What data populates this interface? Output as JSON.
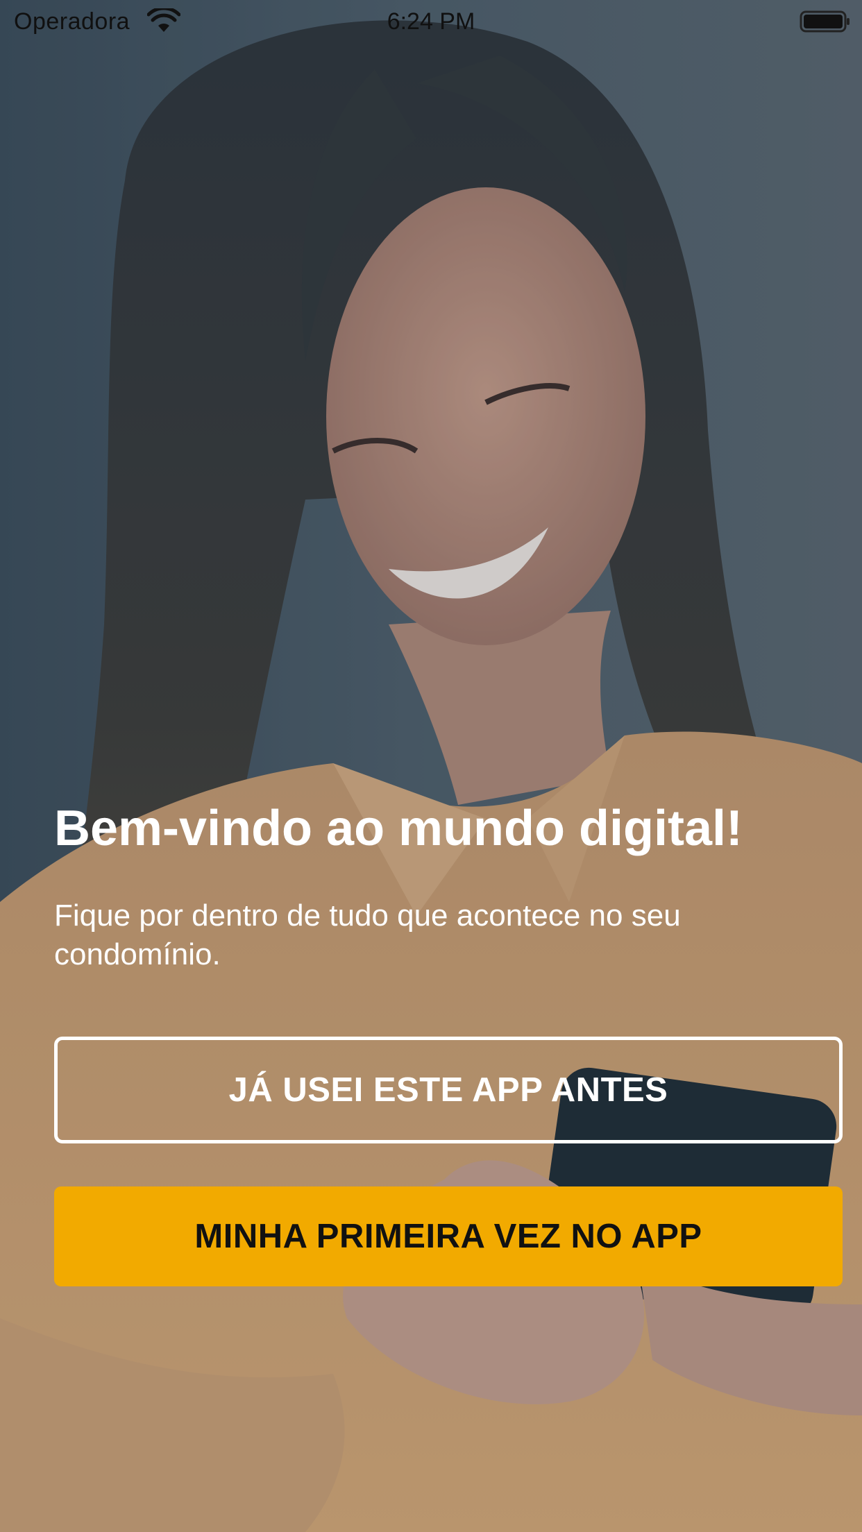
{
  "status_bar": {
    "carrier": "Operadora",
    "time": "6:24 PM",
    "wifi_icon": "wifi-icon",
    "battery_icon": "battery-icon"
  },
  "hero": {
    "background_image": "woman-smiling-looking-at-phone",
    "title": "Bem-vindo ao mundo digital!",
    "subtitle": "Fique por dentro de tudo que acontece no seu condomínio."
  },
  "actions": {
    "returning_user_label": "JÁ USEI ESTE APP ANTES",
    "first_time_label": "MINHA PRIMEIRA VEZ NO APP"
  },
  "colors": {
    "primary_button": "#f2aa00",
    "primary_button_text": "#111111",
    "outline_button": "#ffffff",
    "text": "#ffffff"
  }
}
